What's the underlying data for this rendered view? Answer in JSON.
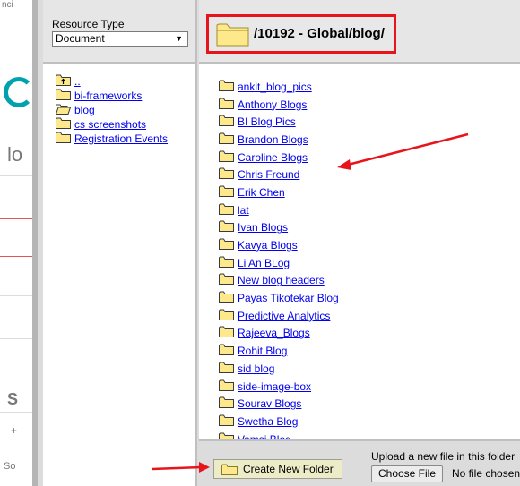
{
  "background": {
    "top_fragment": "nci",
    "lo_fragment": "lo",
    "s_fragment": "S",
    "plus_fragment": "+",
    "so_fragment": "So"
  },
  "resource_type": {
    "label": "Resource Type",
    "selected": "Document"
  },
  "path": {
    "text": "/10192 - Global/blog/"
  },
  "tree": [
    {
      "label": "..",
      "icon": "folder-up-icon"
    },
    {
      "label": "bi-frameworks",
      "icon": "folder-icon"
    },
    {
      "label": "blog",
      "icon": "folder-open-icon"
    },
    {
      "label": "cs screenshots",
      "icon": "folder-icon"
    },
    {
      "label": "Registration Events",
      "icon": "folder-icon"
    }
  ],
  "folders": [
    "ankit_blog_pics",
    "Anthony Blogs",
    "BI Blog Pics",
    "Brandon Blogs",
    "Caroline Blogs",
    "Chris Freund",
    "Erik Chen",
    "lat",
    "Ivan Blogs",
    "Kavya Blogs",
    "Li An BLog",
    "New blog headers",
    "Payas Tikotekar Blog",
    "Predictive Analytics",
    "Rajeeva_Blogs",
    "Rohit Blog",
    "sid blog",
    "side-image-box",
    "Sourav Blogs",
    "Swetha Blog",
    "Vamsi Blog"
  ],
  "bottom": {
    "create_folder": "Create New Folder",
    "upload_label": "Upload a new file in this folder",
    "choose_file": "Choose File",
    "no_file": "No file chosen"
  },
  "colors": {
    "highlight_red": "#e8141c",
    "link_blue": "#0000ee",
    "folder_yellow": "#fde98c"
  }
}
